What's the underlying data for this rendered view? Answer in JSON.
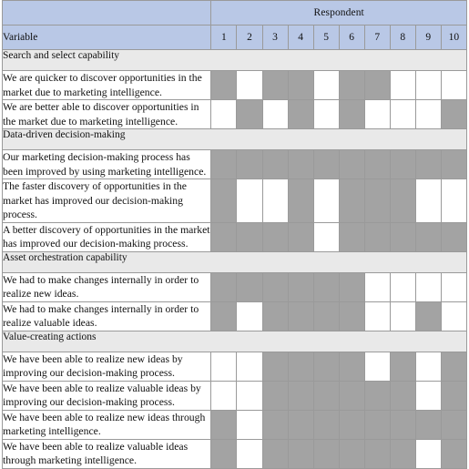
{
  "table": {
    "header": {
      "respondent_label": "Respondent",
      "variable_label": "Variable",
      "respondent_numbers": [
        "1",
        "2",
        "3",
        "4",
        "5",
        "6",
        "7",
        "8",
        "9",
        "10"
      ]
    },
    "colors": {
      "header_blue": "#b9c8e6",
      "section_gray": "#e9e9e9",
      "cell_filled": "#a3a3a3",
      "cell_empty": "#ffffff",
      "border": "#9a9a9a"
    },
    "sections": [
      {
        "title": "Search and select capability",
        "rows": [
          {
            "label": "We are quicker to discover opportunities in the market due to marketing intelligence.",
            "cells": [
              1,
              0,
              1,
              1,
              0,
              1,
              1,
              0,
              0,
              0
            ]
          },
          {
            "label": "We are better able to discover opportunities in the market due to marketing intelligence.",
            "cells": [
              0,
              1,
              0,
              1,
              0,
              1,
              0,
              0,
              0,
              1
            ]
          }
        ]
      },
      {
        "title": "Data-driven decision-making",
        "rows": [
          {
            "label": "Our marketing decision-making process has been improved by using marketing intelligence.",
            "cells": [
              1,
              1,
              1,
              1,
              1,
              1,
              1,
              1,
              1,
              1
            ]
          },
          {
            "label": "The faster discovery of opportunities in the market has improved our decision-making process.",
            "cells": [
              1,
              0,
              0,
              1,
              0,
              1,
              1,
              1,
              0,
              0
            ]
          },
          {
            "label": "A better discovery of opportunities in the market has improved our decision-making process.",
            "cells": [
              1,
              1,
              1,
              1,
              0,
              1,
              1,
              1,
              1,
              1
            ]
          }
        ]
      },
      {
        "title": "Asset orchestration capability",
        "rows": [
          {
            "label": "We had to make changes internally in order to realize new ideas.",
            "cells": [
              1,
              1,
              1,
              1,
              1,
              1,
              0,
              0,
              0,
              0
            ]
          },
          {
            "label": "We had to make changes internally in order to realize valuable ideas.",
            "cells": [
              1,
              0,
              1,
              1,
              1,
              1,
              0,
              0,
              1,
              0
            ]
          }
        ]
      },
      {
        "title": "Value-creating actions",
        "rows": [
          {
            "label": "We have been able to realize new ideas by improving our decision-making process.",
            "cells": [
              0,
              0,
              1,
              1,
              1,
              1,
              0,
              1,
              0,
              1
            ]
          },
          {
            "label": "We have been able to realize valuable ideas by improving our decision-making process.",
            "cells": [
              0,
              0,
              1,
              1,
              1,
              1,
              1,
              1,
              0,
              1
            ]
          },
          {
            "label": "We have been able to realize new ideas through marketing intelligence.",
            "cells": [
              1,
              0,
              1,
              1,
              1,
              1,
              1,
              1,
              1,
              1
            ]
          },
          {
            "label": "We have been able to realize valuable ideas through marketing intelligence.",
            "cells": [
              1,
              0,
              1,
              1,
              1,
              1,
              1,
              1,
              0,
              1
            ]
          }
        ]
      }
    ]
  }
}
